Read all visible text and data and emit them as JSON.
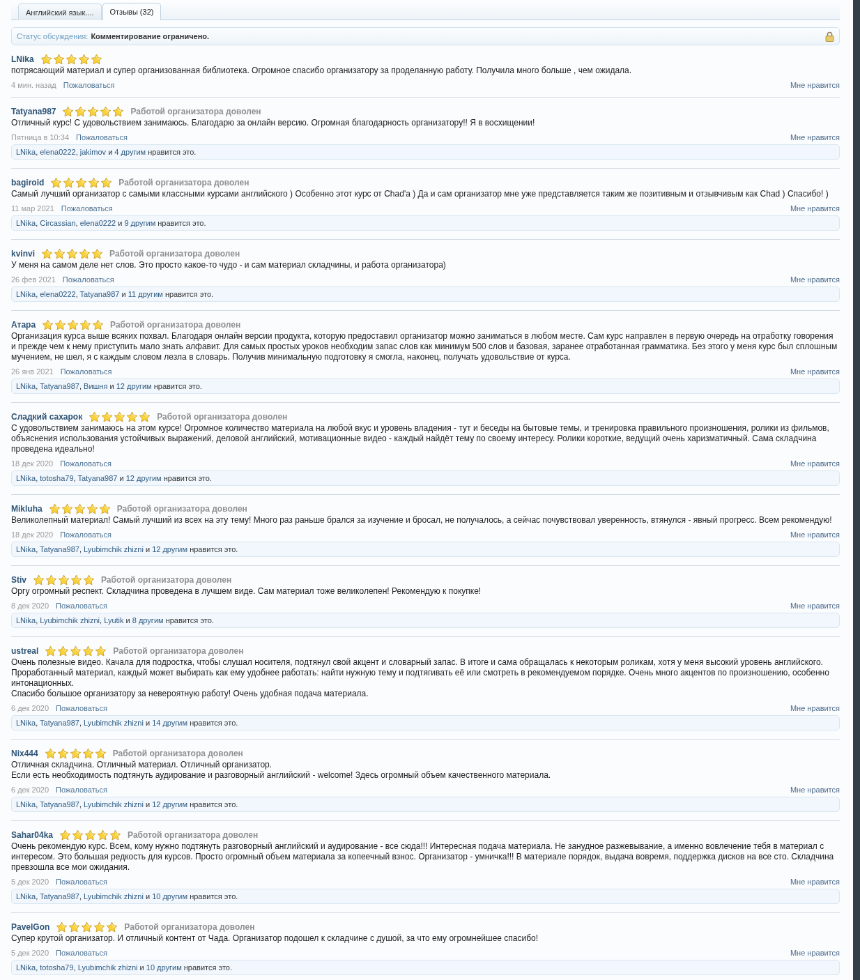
{
  "tabs": [
    {
      "label": "Английский язык....",
      "selected": false
    },
    {
      "label": "Отзывы (32)",
      "selected": true
    }
  ],
  "status": {
    "label": "Статус обсуждения:",
    "value": "Комментирование ограничено."
  },
  "reviews": [
    {
      "author": "LNika",
      "stars": 5,
      "text": "потрясающий материал и супер организованная библиотека. Огромное спасибо организатору за проделанную работу. Получила много больше , чем ожидала.",
      "date": "4 мин. назад",
      "report": "Пожаловаться",
      "like": "Мне нравится"
    },
    {
      "author": "Tatyana987",
      "stars": 5,
      "verdict": "Работой организатора доволен",
      "text": "Отличный курс! С удовольствием занимаюсь. Благодарю за онлайн версию. Огромная благодарность организатору!! Я в восхищении!",
      "date": "Пятница в 10:34",
      "report": "Пожаловаться",
      "like": "Мне нравится",
      "likes": {
        "users": [
          "LNika",
          "elena0222",
          "jakimov"
        ],
        "separator": ",",
        "conjunction": "и",
        "others": "4 другим",
        "suffix": "нравится это."
      }
    },
    {
      "author": "bagiroid",
      "stars": 5,
      "verdict": "Работой организатора доволен",
      "text": "Самый лучший организатор с самыми классными курсами английского ) Особенно этот курс от Chad'а ) Да и сам организатор мне уже представляется таким же позитивным и отзывчивым как Chad ) Спасибо! )",
      "date": "11 мар 2021",
      "report": "Пожаловаться",
      "like": "Мне нравится",
      "likes": {
        "users": [
          "LNika",
          "Circassian",
          "elena0222"
        ],
        "separator": ",",
        "conjunction": "и",
        "others": "9 другим",
        "suffix": "нравится это."
      }
    },
    {
      "author": "kvinvi",
      "stars": 5,
      "verdict": "Работой организатора доволен",
      "text": "У меня на самом деле нет слов. Это просто какое-то чудо - и сам материал складчины, и работа организатора)",
      "date": "26 фев 2021",
      "report": "Пожаловаться",
      "like": "Мне нравится",
      "likes": {
        "users": [
          "LNika",
          "elena0222",
          "Tatyana987"
        ],
        "separator": ",",
        "conjunction": "и",
        "others": "11 другим",
        "suffix": "нравится это."
      }
    },
    {
      "author": "Атара",
      "stars": 5,
      "verdict": "Работой организатора доволен",
      "text": "Организация курса выше всяких похвал. Благодаря онлайн версии продукта, которую предоставил организатор можно заниматься в любом месте. Сам курс направлен в первую очередь на отработку говорения и прежде чем к нему приступить мало знать алфавит. Для самых простых уроков необходим запас слов как минимум 500 слов и базовая, заранее отработанная грамматика. Без этого у меня курс был сплошным мучением, не шел, я с каждым словом лезла в словарь. Получив минимальную подготовку я смогла, наконец, получать удовольствие от курса.",
      "date": "26 янв 2021",
      "report": "Пожаловаться",
      "like": "Мне нравится",
      "likes": {
        "users": [
          "LNika",
          "Tatyana987",
          "Вишня"
        ],
        "separator": ",",
        "conjunction": "и",
        "others": "12 другим",
        "suffix": "нравится это."
      }
    },
    {
      "author": "Сладкий сахарок",
      "stars": 5,
      "verdict": "Работой организатора доволен",
      "text": "С удовольствием занимаюсь на этом курсе! Огромное количество материала на любой вкус и уровень владения - тут и беседы на бытовые темы, и тренировка правильного произношения, ролики из фильмов, объяснения использования устойчивых выражений, деловой английский, мотивационные видео - каждый найдёт тему по своему интересу. Ролики короткие, ведущий очень харизматичный. Сама складчина проведена идеально!",
      "date": "18 дек 2020",
      "report": "Пожаловаться",
      "like": "Мне нравится",
      "likes": {
        "users": [
          "LNika",
          "totosha79",
          "Tatyana987"
        ],
        "separator": ",",
        "conjunction": "и",
        "others": "12 другим",
        "suffix": "нравится это."
      }
    },
    {
      "author": "Mikluha",
      "stars": 5,
      "verdict": "Работой организатора доволен",
      "text": "Великолепный материал! Самый лучший из всех на эту тему! Много раз раньше брался за изучение и бросал, не получалось, а сейчас почувствовал уверенность, втянулся - явный прогресс. Всем рекомендую!",
      "date": "18 дек 2020",
      "report": "Пожаловаться",
      "like": "Мне нравится",
      "likes": {
        "users": [
          "LNika",
          "Tatyana987",
          "Lyubimchik zhizni"
        ],
        "separator": ",",
        "conjunction": "и",
        "others": "12 другим",
        "suffix": "нравится это."
      }
    },
    {
      "author": "Stiv",
      "stars": 5,
      "verdict": "Работой организатора доволен",
      "text": "Оргу огромный респект. Складчина проведена в лучшем виде. Сам материал тоже великолепен! Рекомендую к покупке!",
      "date": "8 дек 2020",
      "report": "Пожаловаться",
      "like": "Мне нравится",
      "likes": {
        "users": [
          "LNika",
          "Lyubimchik zhizni",
          "Lyutik"
        ],
        "separator": ",",
        "conjunction": "и",
        "others": "8 другим",
        "suffix": "нравится это."
      }
    },
    {
      "author": "ustreal",
      "stars": 5,
      "verdict": "Работой организатора доволен",
      "text": "Очень полезные видео. Качала для подростка, чтобы слушал носителя, подтянул свой акцент и словарный запас. В итоге и сама обращалась к некоторым роликам, хотя у меня высокий уровень английского. Проработанный материал, каждый может выбирать как ему удобнее работать: найти нужную тему и подтягивать её или смотреть в рекомендуемом порядке. Очень много акцентов по произношению, особенно интонационных.\nСпасибо большое организатору за невероятную работу! Очень удобная подача материала.",
      "date": "6 дек 2020",
      "report": "Пожаловаться",
      "like": "Мне нравится",
      "likes": {
        "users": [
          "LNika",
          "Tatyana987",
          "Lyubimchik zhizni"
        ],
        "separator": ",",
        "conjunction": "и",
        "others": "14 другим",
        "suffix": "нравится это."
      }
    },
    {
      "author": "Nix444",
      "stars": 5,
      "verdict": "Работой организатора доволен",
      "text": "Отличная складчина. Отличный материал. Отличный организатор.\nЕсли есть необходимость подтянуть аудирование и разговорный английский - welcome! Здесь огромный объем качественного материала.",
      "date": "6 дек 2020",
      "report": "Пожаловаться",
      "like": "Мне нравится",
      "likes": {
        "users": [
          "LNika",
          "Tatyana987",
          "Lyubimchik zhizni"
        ],
        "separator": ",",
        "conjunction": "и",
        "others": "12 другим",
        "suffix": "нравится это."
      }
    },
    {
      "author": "Sahar04ka",
      "stars": 5,
      "verdict": "Работой организатора доволен",
      "text": "Очень рекомендую курс. Всем, кому нужно подтянуть разговорный английский и аудирование - все сюда!!! Интересная подача материала. Не занудное разжевывание, а именно вовлечение тебя в материал с интересом. Это большая редкость для курсов. Просто огромный объем материала за копеечный взнос. Организатор - умничка!!! В материале порядок, выдача вовремя, поддержка дисков на все сто. Складчина превзошла все мои ожидания.",
      "date": "5 дек 2020",
      "report": "Пожаловаться",
      "like": "Мне нравится",
      "likes": {
        "users": [
          "LNika",
          "Tatyana987",
          "Lyubimchik zhizni"
        ],
        "separator": ",",
        "conjunction": "и",
        "others": "10 другим",
        "suffix": "нравится это."
      }
    },
    {
      "author": "PavelGon",
      "stars": 5,
      "verdict": "Работой организатора доволен",
      "text": "Супер крутой организатор. И отличный контент от Чада. Организатор подошел к складчине с душой, за что ему огромнейшее спасибо!",
      "date": "5 дек 2020",
      "report": "Пожаловаться",
      "like": "Мне нравится",
      "likes": {
        "users": [
          "LNika",
          "totosha79",
          "Lyubimchik zhizni"
        ],
        "separator": ",",
        "conjunction": "и",
        "others": "10 другим",
        "suffix": "нравится это."
      }
    }
  ]
}
